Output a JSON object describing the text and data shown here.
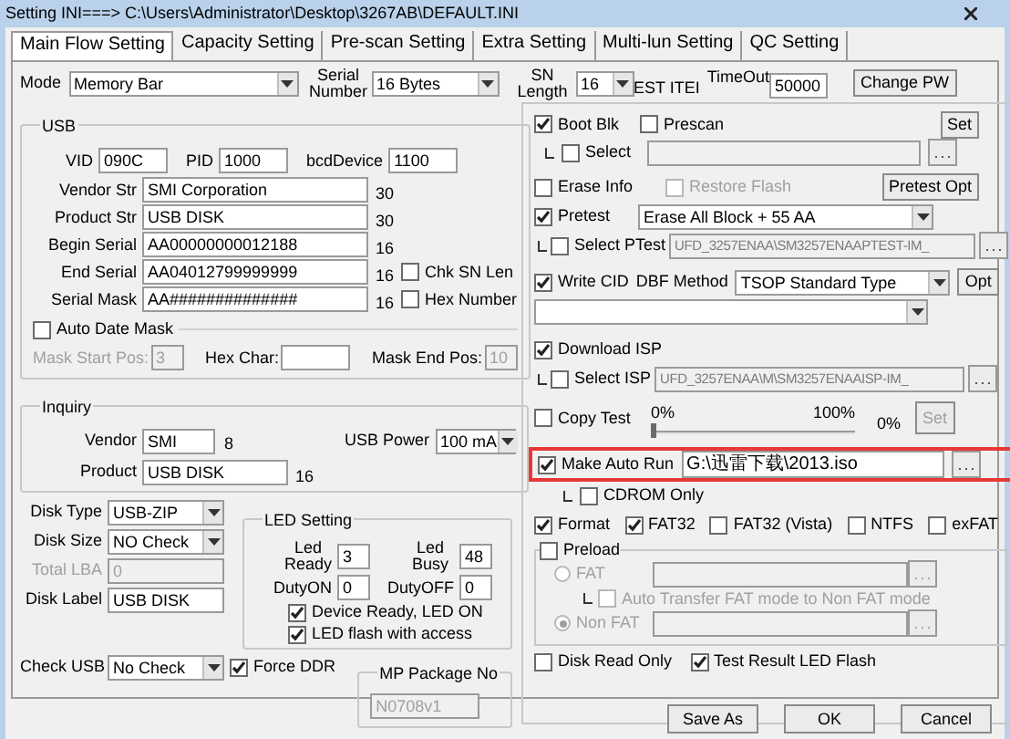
{
  "window": {
    "title": "Setting  INI===> C:\\Users\\Administrator\\Desktop\\3267AB\\DEFAULT.INI"
  },
  "tabs": [
    {
      "label": "Main Flow Setting",
      "selected": true
    },
    {
      "label": "Capacity Setting",
      "selected": false
    },
    {
      "label": "Pre-scan Setting",
      "selected": false
    },
    {
      "label": "Extra Setting",
      "selected": false
    },
    {
      "label": "Multi-lun Setting",
      "selected": false
    },
    {
      "label": "QC Setting",
      "selected": false
    }
  ],
  "mode": {
    "label": "Mode",
    "value": "Memory Bar"
  },
  "serial_number": {
    "label": "Serial Number",
    "value": "16 Bytes"
  },
  "sn_length": {
    "label": "SN Length",
    "value": "16"
  },
  "est_label": "EST ITEI",
  "timeout": {
    "label": "TimeOut",
    "value": "50000"
  },
  "change_pw": "Change PW",
  "usb": {
    "title": "USB",
    "ids": [
      {
        "label": "VID",
        "value": "090C"
      },
      {
        "label": "PID",
        "value": "1000"
      },
      {
        "label": "bcdDevice",
        "value": "1100"
      }
    ],
    "strings": [
      {
        "label": "Vendor Str",
        "value": "SMI Corporation",
        "length": "30"
      },
      {
        "label": "Product Str",
        "value": "USB DISK",
        "length": "30"
      },
      {
        "label": "Begin Serial",
        "value": "AA00000000012188",
        "length": "16"
      },
      {
        "label": "End Serial",
        "value": "AA04012799999999",
        "length": "16",
        "option": {
          "label": "Chk SN Len",
          "checked": false
        }
      },
      {
        "label": "Serial Mask",
        "value": "AA##############",
        "length": "16",
        "option": {
          "label": "Hex Number",
          "checked": false
        }
      }
    ],
    "auto_date_mask": {
      "label": "Auto Date Mask",
      "checked": false
    },
    "mask_fields": [
      {
        "label": "Mask Start Pos:",
        "value": "3",
        "disabled": true
      },
      {
        "label": "Hex Char:",
        "disabled": false
      },
      {
        "label": "Mask End Pos:",
        "value": "10",
        "disabled": false
      }
    ]
  },
  "inquiry": {
    "title": "Inquiry",
    "vendor": {
      "label": "Vendor",
      "value": "SMI",
      "length": "8"
    },
    "product": {
      "label": "Product",
      "value": "USB DISK",
      "length": "16"
    },
    "usb_power": {
      "label": "USB Power",
      "value": "100 mA"
    }
  },
  "disk": [
    {
      "kind": "combo",
      "label": "Disk Type",
      "value": "USB-ZIP",
      "disabled": false
    },
    {
      "kind": "combo",
      "label": "Disk Size",
      "value": "NO Check",
      "disabled": false
    },
    {
      "kind": "text",
      "label": "Total LBA",
      "value": "0",
      "disabled": true
    },
    {
      "kind": "text",
      "label": "Disk Label",
      "value": "USB DISK",
      "disabled": false
    }
  ],
  "check_usb": {
    "label": "Check USB",
    "value": "No Check"
  },
  "force_ddr": {
    "label": "Force DDR",
    "checked": true
  },
  "led": {
    "title": "LED Setting",
    "fields": [
      {
        "label": "Led Ready",
        "value": "3"
      },
      {
        "label": "Led Busy",
        "value": "48"
      },
      {
        "label": "DutyON",
        "value": "0"
      },
      {
        "label": "DutyOFF",
        "value": "0"
      }
    ],
    "options": [
      {
        "label": "Device Ready, LED ON",
        "checked": true
      },
      {
        "label": "LED flash with access",
        "checked": true
      }
    ]
  },
  "mp_package": {
    "title": "MP Package No",
    "value": "N0708v1"
  },
  "boot_blk": {
    "label": "Boot Blk",
    "checked": true
  },
  "prescan": {
    "label": "Prescan",
    "checked": false
  },
  "prescan_set": "Set",
  "boot_select": {
    "label": "Select",
    "checked": false
  },
  "erase_info": {
    "label": "Erase Info",
    "checked": false
  },
  "restore_flash": {
    "label": "Restore Flash",
    "checked": false,
    "disabled": true
  },
  "pretest_opt": "Pretest Opt",
  "pretest": {
    "label": "Pretest",
    "checked": true,
    "value": "Erase All Block + 55 AA"
  },
  "select_ptest": {
    "label": "Select PTest",
    "checked": false,
    "path": "UFD_3257ENAA\\SM3257ENAAPTEST-IM_"
  },
  "write_cid": {
    "label": "Write CID",
    "checked": true
  },
  "dbf_method": {
    "label": "DBF Method",
    "value": "TSOP Standard Type"
  },
  "dbf_opt": "Opt",
  "download_isp": {
    "label": "Download ISP",
    "checked": true
  },
  "select_isp": {
    "label": "Select ISP",
    "checked": false,
    "path": "UFD_3257ENAA\\M\\SM3257ENAAISP-IM_"
  },
  "copy_test": {
    "label": "Copy Test",
    "checked": false,
    "min": "0%",
    "max": "100%",
    "level": 0,
    "reading": "0%",
    "set": {
      "label": "Set",
      "disabled": true
    }
  },
  "make_auto_run": {
    "label": "Make Auto Run",
    "checked": true,
    "highlighted": true,
    "path": "G:\\迅雷下载\\2013.iso"
  },
  "cdrom_only": {
    "label": "CDROM Only",
    "checked": false
  },
  "format": [
    {
      "label": "Format",
      "checked": true
    },
    {
      "label": "FAT32",
      "checked": true
    },
    {
      "label": "FAT32 (Vista)",
      "checked": false
    },
    {
      "label": "NTFS",
      "checked": false
    },
    {
      "label": "exFAT",
      "checked": false
    }
  ],
  "preload": {
    "label": "Preload",
    "checked": false,
    "modes": [
      {
        "label": "FAT",
        "selected": false,
        "disabled": true
      },
      {
        "label": "Non FAT",
        "selected": true,
        "disabled": true
      }
    ],
    "auto_transfer": {
      "label": "Auto Transfer FAT mode to Non FAT mode",
      "checked": false,
      "disabled": true
    }
  },
  "disk_read_only": {
    "label": "Disk Read Only",
    "checked": false
  },
  "test_result_led_flash": {
    "label": "Test Result LED Flash",
    "checked": true
  },
  "buttons": [
    "Save As",
    "OK",
    "Cancel"
  ]
}
